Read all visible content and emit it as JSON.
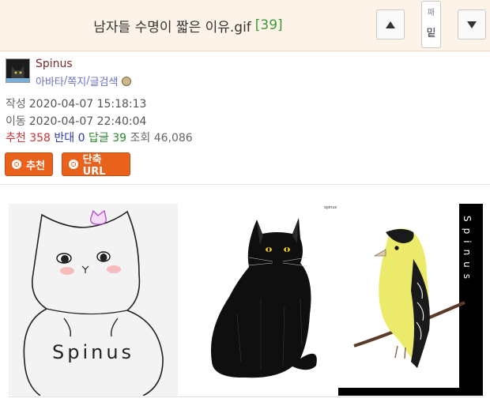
{
  "header": {
    "title": "남자들 수명이 짧은 이유.gif",
    "reply_count": "[39]",
    "up_icon": "triangle-up-icon",
    "down_icon": "triangle-down-icon",
    "mid_top": "패",
    "mid_bottom": "밑"
  },
  "author": {
    "name": "Spinus",
    "link_avatar": "아바타",
    "sep1": "/",
    "link_message": "쪽지",
    "sep2": "/",
    "link_posts": "글검색",
    "badge_icon": "level-badge-icon"
  },
  "meta": {
    "created_label": "작성",
    "created_value": "2020-04-07 15:18:13",
    "moved_label": "이동",
    "moved_value": "2020-04-07 22:40:04",
    "recommend_label": "추천",
    "recommend_value": "358",
    "oppose_label": "반대",
    "oppose_value": "0",
    "reply_label": "답글",
    "reply_value": "39",
    "views_label": "조회",
    "views_value": "46,086"
  },
  "actions": {
    "recommend_label": "추천",
    "shorturl_label": "단축URL"
  },
  "images": {
    "drawing1_text": "Spinus",
    "drawing2_sig": "spinus",
    "drawing3_side": "Spinus"
  },
  "colors": {
    "topbar_bg": "#fdf3e9",
    "button_orange": "#e8621c",
    "recommend": "#cc3333",
    "oppose": "#2a3ab0",
    "reply": "#2a8a2a"
  }
}
